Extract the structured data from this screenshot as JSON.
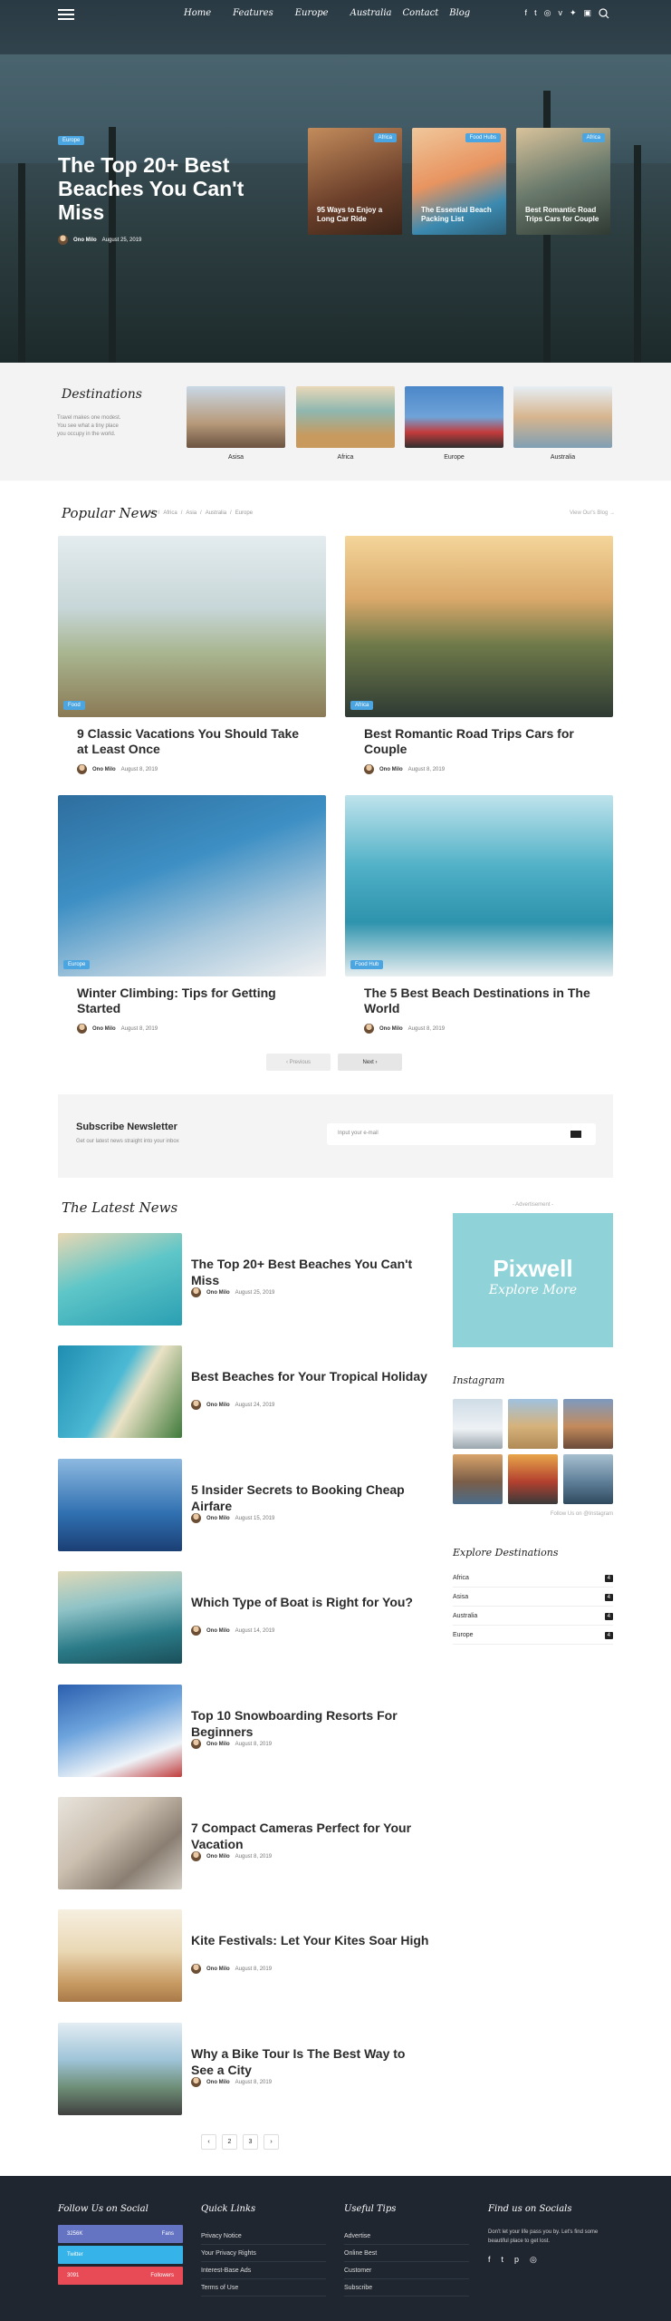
{
  "nav": {
    "menu_icon": "hamburger-menu-icon",
    "links": [
      "Home",
      "Features",
      "Europe",
      "Australia",
      "Contact",
      "Blog"
    ],
    "social_icons": [
      "f",
      "t",
      "◎",
      "v",
      "✦",
      "▣"
    ],
    "search_icon": "search-icon"
  },
  "hero": {
    "tag": "Europe",
    "title": "The Top 20+ Best Beaches You Can't Miss",
    "author": "Ono Milo",
    "date": "August 25, 2019",
    "cards": [
      {
        "tag": "Africa",
        "title": "95 Ways to Enjoy a Long Car Ride"
      },
      {
        "tag": "Food Hubs",
        "title": "The Essential Beach Packing List"
      },
      {
        "tag": "Africa",
        "title": "Best Romantic Road Trips Cars for Couple"
      }
    ]
  },
  "destinations": {
    "title": "Destinations",
    "desc": "Travel makes one modest. You see what a tiny place you occupy in the world.",
    "items": [
      "Asisa",
      "Africa",
      "Europe",
      "Australia"
    ]
  },
  "popular": {
    "title": "Popular News",
    "filters": [
      "All",
      "Africa",
      "Asia",
      "Australia",
      "Europe"
    ],
    "view_all": "View Our's Blog →",
    "posts": [
      {
        "tag": "Food",
        "title": "9 Classic Vacations You Should Take at Least Once",
        "author": "Ono Milo",
        "date": "August 8, 2019"
      },
      {
        "tag": "Africa",
        "title": "Best Romantic Road Trips Cars for Couple",
        "author": "Ono Milo",
        "date": "August 8, 2019"
      },
      {
        "tag": "Europe",
        "title": "Winter Climbing: Tips for Getting Started",
        "author": "Ono Milo",
        "date": "August 8, 2019"
      },
      {
        "tag": "Food Hub",
        "title": "The 5 Best Beach Destinations in The World",
        "author": "Ono Milo",
        "date": "August 8, 2019"
      }
    ],
    "prev": "‹ Previous",
    "next": "Next ›"
  },
  "newsletter": {
    "title": "Subscribe Newsletter",
    "subtitle": "Get our latest news straight into your inbox",
    "placeholder": "Input your e-mail"
  },
  "latest": {
    "title": "The Latest News",
    "items": [
      {
        "title": "The Top 20+ Best Beaches You Can't Miss",
        "author": "Ono Milo",
        "date": "August 25, 2019"
      },
      {
        "title": "Best Beaches for Your Tropical Holiday",
        "author": "Ono Milo",
        "date": "August 24, 2019"
      },
      {
        "title": "5 Insider Secrets to Booking Cheap Airfare",
        "author": "Ono Milo",
        "date": "August 15, 2019"
      },
      {
        "title": "Which Type of Boat is Right for You?",
        "author": "Ono Milo",
        "date": "August 14, 2019"
      },
      {
        "title": "Top 10 Snowboarding Resorts For Beginners",
        "author": "Ono Milo",
        "date": "August 8, 2019"
      },
      {
        "title": "7 Compact Cameras Perfect for Your Vacation",
        "author": "Ono Milo",
        "date": "August 8, 2019"
      },
      {
        "title": "Kite Festivals: Let Your Kites Soar High",
        "author": "Ono Milo",
        "date": "August 8, 2019"
      },
      {
        "title": "Why a Bike Tour Is The Best Way to See a City",
        "author": "Ono Milo",
        "date": "August 8, 2019"
      }
    ],
    "pages": [
      "‹",
      "2",
      "3",
      "›"
    ]
  },
  "sidebar": {
    "ad_label": "- Advertisement -",
    "ad_title": "Pixwell",
    "ad_sub": "Explore More",
    "instagram_title": "Instagram",
    "instagram_note": "Follow Us on @Instagram",
    "explore_title": "Explore Destinations",
    "explore": [
      {
        "name": "Africa",
        "count": "4"
      },
      {
        "name": "Asisa",
        "count": "4"
      },
      {
        "name": "Australia",
        "count": "4"
      },
      {
        "name": "Europe",
        "count": "4"
      }
    ]
  },
  "footer": {
    "follow_title": "Follow Us on Social",
    "social": [
      {
        "name": "facebook",
        "count": "3256K",
        "label": "Fans"
      },
      {
        "name": "twitter",
        "count": "",
        "label": "Twitter"
      },
      {
        "name": "pinterest",
        "count": "3091",
        "label": "Followers"
      }
    ],
    "quick_title": "Quick Links",
    "quick": [
      "Privacy Notice",
      "Your Privacy Rights",
      "Interest-Base Ads",
      "Terms of Use"
    ],
    "tips_title": "Useful Tips",
    "tips": [
      "Advertise",
      "Online Best",
      "Customer",
      "Subscribe"
    ],
    "find_title": "Find us on Socials",
    "find_text": "Don't let your life pass you by. Let's find some beautiful place to get lost.",
    "find_icons": [
      "f",
      "t",
      "p",
      "◎"
    ]
  },
  "colors": {
    "accent": "#4aa5e0",
    "footer_bg": "#1f2630",
    "facebook": "#6474c2",
    "twitter": "#36b3e8",
    "pinterest": "#e84a56"
  }
}
